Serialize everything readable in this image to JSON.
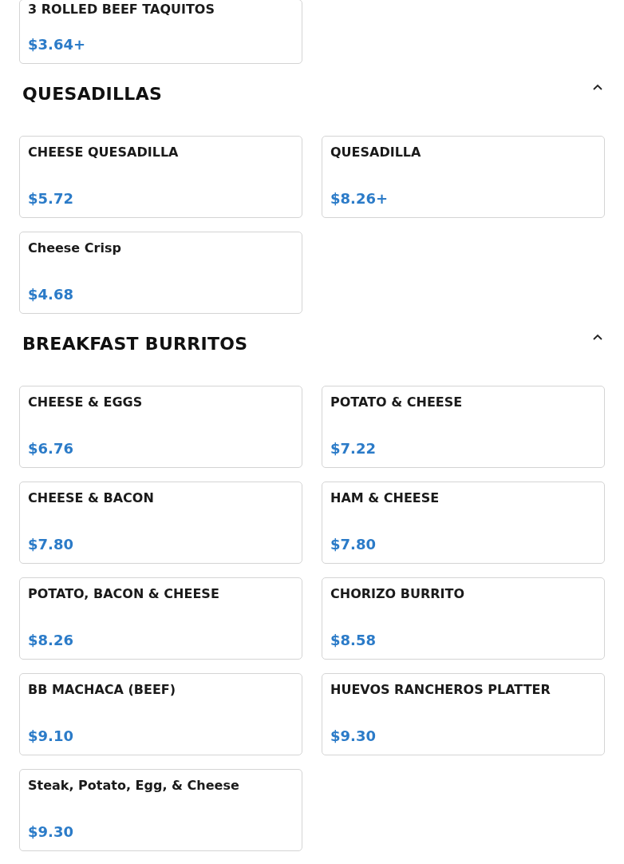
{
  "sections": [
    {
      "items": [
        {
          "name": "3 ROLLED BEEF TAQUITOS",
          "price": "$3.64+"
        }
      ]
    },
    {
      "title": "QUESADILLAS",
      "expanded": true,
      "items": [
        {
          "name": "CHEESE QUESADILLA",
          "price": "$5.72"
        },
        {
          "name": "QUESADILLA",
          "price": "$8.26+"
        },
        {
          "name": "Cheese Crisp",
          "price": "$4.68"
        }
      ]
    },
    {
      "title": "BREAKFAST BURRITOS",
      "expanded": true,
      "items": [
        {
          "name": "CHEESE & EGGS",
          "price": "$6.76"
        },
        {
          "name": "POTATO & CHEESE",
          "price": "$7.22"
        },
        {
          "name": "CHEESE & BACON",
          "price": "$7.80"
        },
        {
          "name": "HAM & CHEESE",
          "price": "$7.80"
        },
        {
          "name": "POTATO, BACON & CHEESE",
          "price": "$8.26"
        },
        {
          "name": "CHORIZO BURRITO",
          "price": "$8.58"
        },
        {
          "name": "BB MACHACA (BEEF)",
          "price": "$9.10"
        },
        {
          "name": "HUEVOS RANCHEROS PLATTER",
          "price": "$9.30"
        },
        {
          "name": "Steak, Potato, Egg, & Cheese",
          "price": "$9.30"
        }
      ]
    }
  ]
}
